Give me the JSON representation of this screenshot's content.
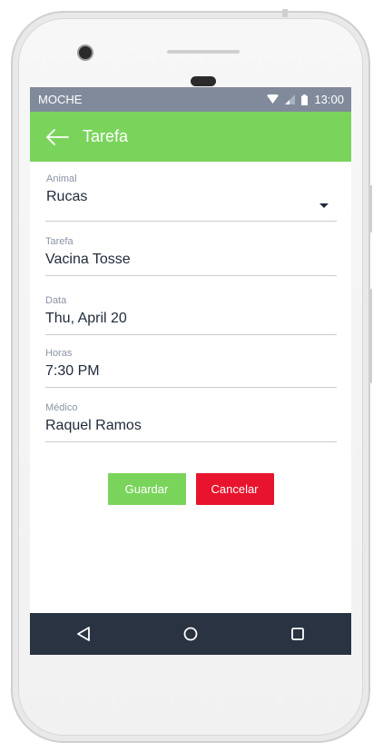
{
  "status_bar": {
    "carrier": "MOCHE",
    "time": "13:00",
    "icons": [
      "wifi-icon",
      "signal-icon",
      "battery-icon"
    ]
  },
  "app_bar": {
    "title": "Tarefa",
    "back_icon": "arrow-left-icon"
  },
  "form": {
    "animal": {
      "label": "Animal",
      "value": "Rucas"
    },
    "tarefa": {
      "label": "Tarefa",
      "value": "Vacina Tosse"
    },
    "data": {
      "label": "Data",
      "value": "Thu, April 20"
    },
    "horas": {
      "label": "Horas",
      "value": "7:30 PM"
    },
    "medico": {
      "label": "Médico",
      "value": "Raquel Ramos"
    }
  },
  "buttons": {
    "save_label": "Guardar",
    "cancel_label": "Cancelar"
  },
  "navigation": {
    "items": [
      "back-triangle-icon",
      "home-circle-icon",
      "recents-square-icon"
    ]
  },
  "colors": {
    "accent_green": "#7ad45c",
    "status_bar": "#818a9b",
    "nav_bar": "#2a3342",
    "cancel_red": "#e8142e"
  }
}
